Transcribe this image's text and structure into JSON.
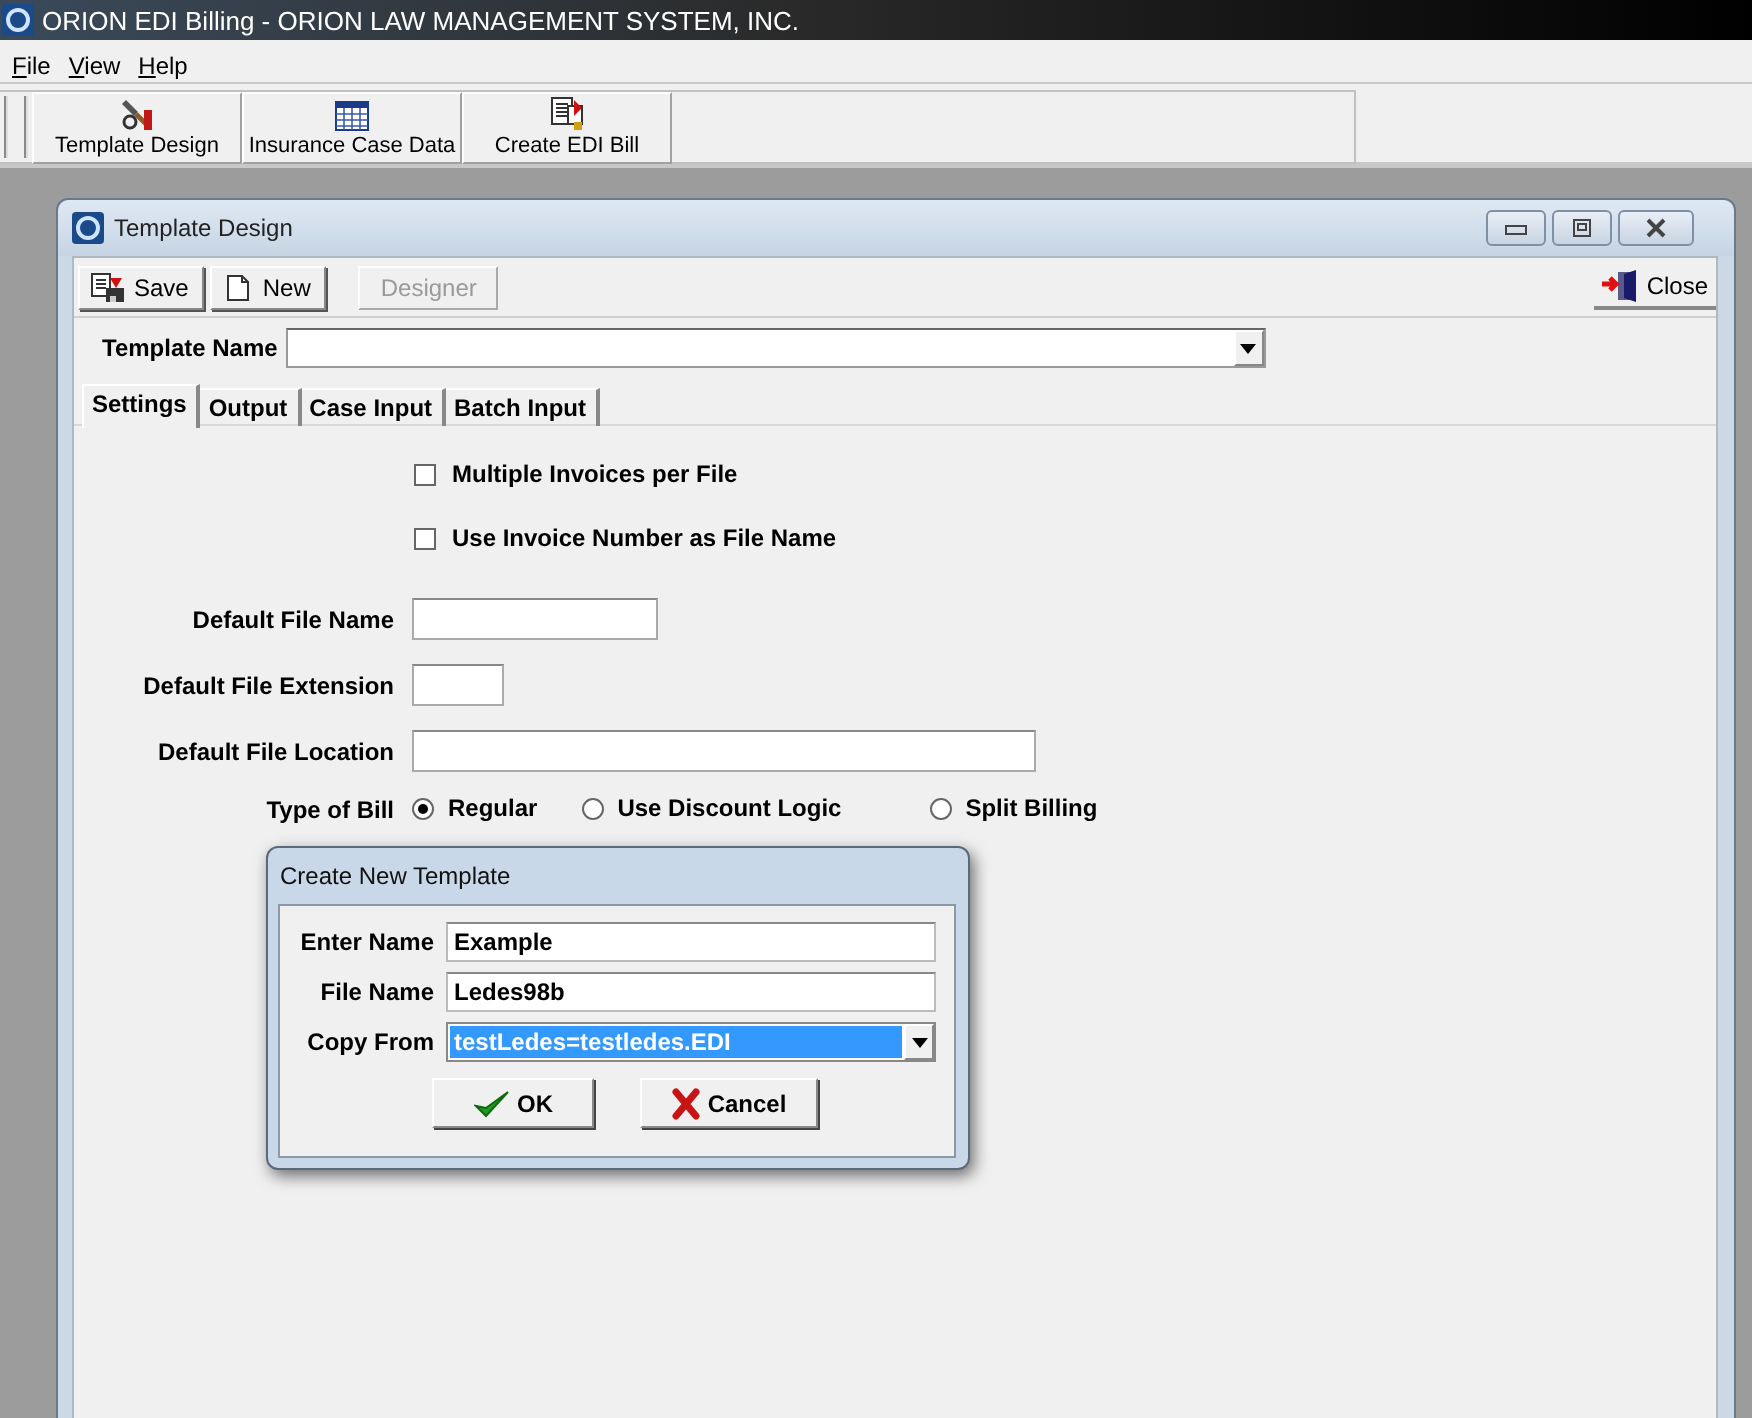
{
  "app": {
    "title": "ORION EDI Billing - ORION LAW MANAGEMENT SYSTEM, INC."
  },
  "menu": [
    {
      "label": "File"
    },
    {
      "label": "View"
    },
    {
      "label": "Help"
    }
  ],
  "toolbar": [
    {
      "label": "Template Design"
    },
    {
      "label": "Insurance Case Data"
    },
    {
      "label": "Create EDI Bill"
    }
  ],
  "child_window": {
    "title": "Template Design",
    "buttons": [
      {
        "label": "Save",
        "disabled": false
      },
      {
        "label": "New",
        "disabled": false
      },
      {
        "label": "Designer",
        "disabled": true
      }
    ],
    "close_button": {
      "label": "Close"
    },
    "template_name": {
      "label": "Template Name"
    },
    "tabs": [
      {
        "label": "Settings",
        "selected": true
      },
      {
        "label": "Output",
        "selected": false
      },
      {
        "label": "Case Input",
        "selected": false
      },
      {
        "label": "Batch Input",
        "selected": false
      }
    ],
    "checkboxes": [
      {
        "label": "Multiple Invoices per File",
        "checked": false
      },
      {
        "label": "Use Invoice Number as File Name",
        "checked": false
      }
    ],
    "fields": [
      {
        "label": "Default File Name"
      },
      {
        "label": "Default File Extension"
      },
      {
        "label": "Default File Location"
      }
    ],
    "bill_type": {
      "label": "Type of Bill",
      "options": [
        {
          "label": "Regular",
          "selected": true
        },
        {
          "label": "Use Discount Logic",
          "selected": false
        },
        {
          "label": "Split Billing",
          "selected": false
        }
      ]
    }
  },
  "dialog": {
    "title": "Create New Template",
    "fields": [
      {
        "label": "Enter Name",
        "value": "Example",
        "kind": "text"
      },
      {
        "label": "File Name",
        "value": "Ledes98b",
        "kind": "text"
      },
      {
        "label": "Copy From",
        "value": "testLedes=testledes.EDI",
        "kind": "dropdown",
        "highlighted": true
      }
    ],
    "buttons": [
      {
        "label": "OK"
      },
      {
        "label": "Cancel"
      }
    ]
  }
}
